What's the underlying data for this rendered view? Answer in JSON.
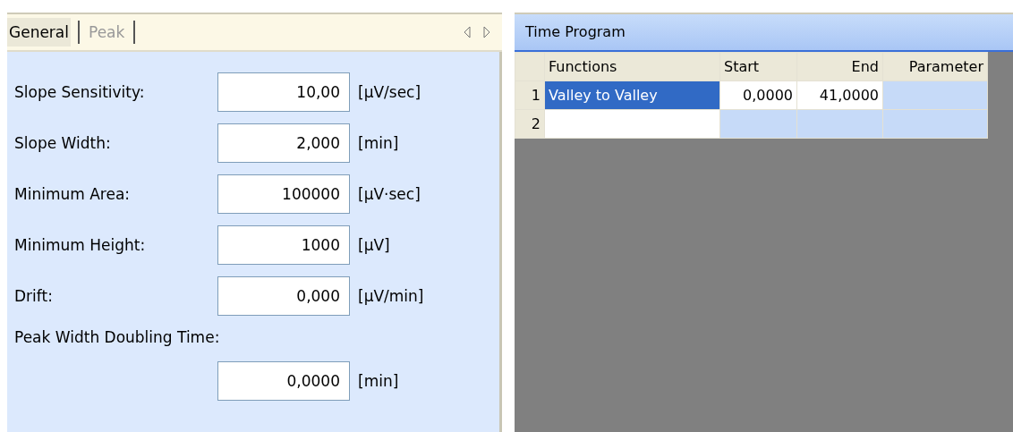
{
  "left_panel": {
    "tabs": [
      {
        "label": "General",
        "selected": true
      },
      {
        "label": "Peak",
        "selected": false
      }
    ],
    "fields": [
      {
        "label": "Slope Sensitivity:",
        "value": "10,00",
        "unit": "[µV/sec]",
        "kind": "inline"
      },
      {
        "label": "Slope Width:",
        "value": "2,000",
        "unit": "[min]",
        "kind": "inline"
      },
      {
        "label": "Minimum Area:",
        "value": "100000",
        "unit": "[µV·sec]",
        "kind": "inline"
      },
      {
        "label": "Minimum Height:",
        "value": "1000",
        "unit": "[µV]",
        "kind": "inline"
      },
      {
        "label": "Drift:",
        "value": "0,000",
        "unit": "[µV/min]",
        "kind": "inline"
      },
      {
        "label": "Peak Width Doubling Time:",
        "value": "0,0000",
        "unit": "[min]",
        "kind": "stacked"
      }
    ]
  },
  "time_program": {
    "title": "Time Program",
    "columns": [
      "Functions",
      "Start",
      "End",
      "Parameter"
    ],
    "rows": [
      {
        "number": "1",
        "cells": [
          {
            "text": "Valley to Valley",
            "selected": true,
            "shaded": false
          },
          {
            "text": "0,0000",
            "selected": false,
            "shaded": false
          },
          {
            "text": "41,0000",
            "selected": false,
            "shaded": false
          },
          {
            "text": "",
            "selected": false,
            "shaded": true
          }
        ]
      },
      {
        "number": "2",
        "cells": [
          {
            "text": "",
            "selected": false,
            "shaded": false
          },
          {
            "text": "",
            "selected": false,
            "shaded": true
          },
          {
            "text": "",
            "selected": false,
            "shaded": true
          },
          {
            "text": "",
            "selected": false,
            "shaded": true
          }
        ]
      }
    ]
  }
}
